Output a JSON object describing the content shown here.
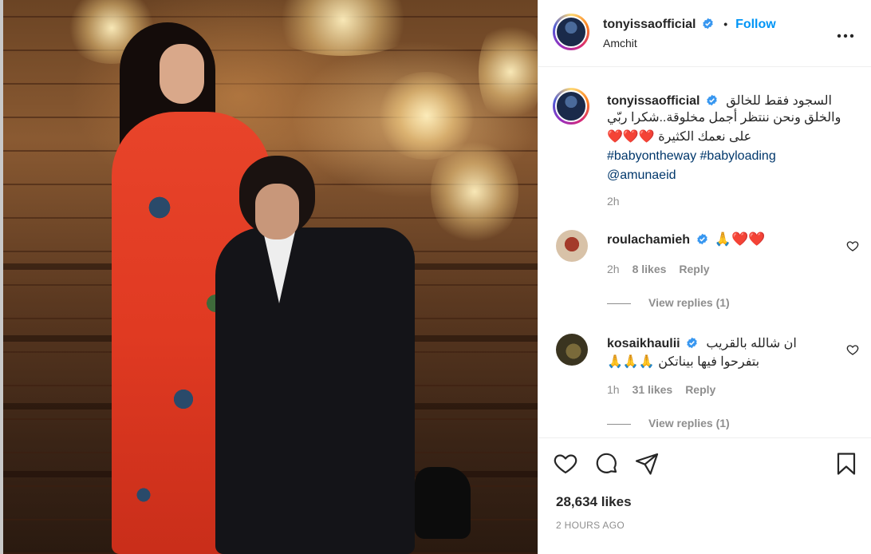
{
  "post": {
    "username": "tonyissaofficial",
    "follow_label": "Follow",
    "separator": "•",
    "location": "Amchit",
    "more_label": "•••"
  },
  "caption": {
    "username": "tonyissaofficial",
    "line1": "السجود فقط للخالق",
    "line2": "والخلق ونحن ننتظر أجمل مخلوقة..شكرا ربّي",
    "line3": "على نعمك الكثيرة ❤️❤️❤️",
    "hashtags": "#babyontheway #babyloading",
    "mention": "@amunaeid",
    "time": "2h"
  },
  "comments": [
    {
      "username": "roulachamieh",
      "text": "🙏❤️❤️",
      "time": "2h",
      "likes": "8 likes",
      "reply_label": "Reply",
      "view_replies": "View replies (1)"
    },
    {
      "username": "kosaikhaulii",
      "text_line1": "ان شالله بالقريب",
      "text_line2": "بتفرحوا فيها بيناتكن 🙏🙏🙏",
      "time": "1h",
      "likes": "31 likes",
      "reply_label": "Reply",
      "view_replies": "View replies (1)"
    }
  ],
  "footer": {
    "likes_count": "28,634 likes",
    "time_ago": "2 HOURS AGO"
  },
  "icons": {
    "like": "heart-icon",
    "comment": "comment-icon",
    "share": "share-icon",
    "save": "bookmark-icon",
    "verified": "verified-badge-icon",
    "more": "more-options-icon"
  },
  "colors": {
    "follow": "#0095f6",
    "hashtag": "#00376b",
    "muted": "#8e8e8e",
    "verified": "#3897f0",
    "dress": "#e03a22"
  }
}
